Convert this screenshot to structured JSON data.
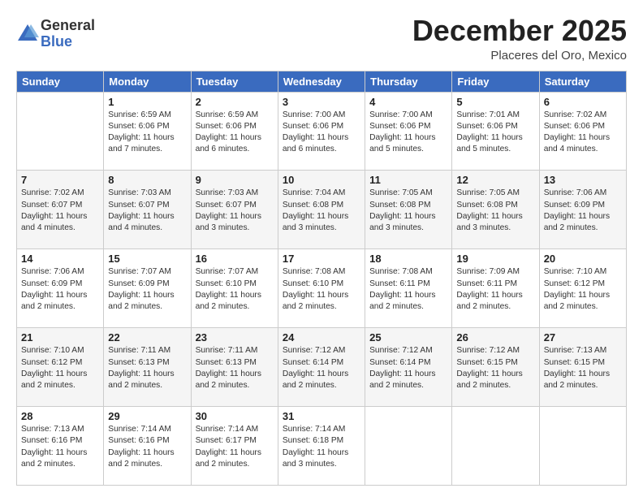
{
  "logo": {
    "general": "General",
    "blue": "Blue"
  },
  "header": {
    "month": "December 2025",
    "location": "Placeres del Oro, Mexico"
  },
  "weekdays": [
    "Sunday",
    "Monday",
    "Tuesday",
    "Wednesday",
    "Thursday",
    "Friday",
    "Saturday"
  ],
  "weeks": [
    [
      {
        "day": "",
        "info": ""
      },
      {
        "day": "1",
        "info": "Sunrise: 6:59 AM\nSunset: 6:06 PM\nDaylight: 11 hours\nand 7 minutes."
      },
      {
        "day": "2",
        "info": "Sunrise: 6:59 AM\nSunset: 6:06 PM\nDaylight: 11 hours\nand 6 minutes."
      },
      {
        "day": "3",
        "info": "Sunrise: 7:00 AM\nSunset: 6:06 PM\nDaylight: 11 hours\nand 6 minutes."
      },
      {
        "day": "4",
        "info": "Sunrise: 7:00 AM\nSunset: 6:06 PM\nDaylight: 11 hours\nand 5 minutes."
      },
      {
        "day": "5",
        "info": "Sunrise: 7:01 AM\nSunset: 6:06 PM\nDaylight: 11 hours\nand 5 minutes."
      },
      {
        "day": "6",
        "info": "Sunrise: 7:02 AM\nSunset: 6:06 PM\nDaylight: 11 hours\nand 4 minutes."
      }
    ],
    [
      {
        "day": "7",
        "info": "Sunrise: 7:02 AM\nSunset: 6:07 PM\nDaylight: 11 hours\nand 4 minutes."
      },
      {
        "day": "8",
        "info": "Sunrise: 7:03 AM\nSunset: 6:07 PM\nDaylight: 11 hours\nand 4 minutes."
      },
      {
        "day": "9",
        "info": "Sunrise: 7:03 AM\nSunset: 6:07 PM\nDaylight: 11 hours\nand 3 minutes."
      },
      {
        "day": "10",
        "info": "Sunrise: 7:04 AM\nSunset: 6:08 PM\nDaylight: 11 hours\nand 3 minutes."
      },
      {
        "day": "11",
        "info": "Sunrise: 7:05 AM\nSunset: 6:08 PM\nDaylight: 11 hours\nand 3 minutes."
      },
      {
        "day": "12",
        "info": "Sunrise: 7:05 AM\nSunset: 6:08 PM\nDaylight: 11 hours\nand 3 minutes."
      },
      {
        "day": "13",
        "info": "Sunrise: 7:06 AM\nSunset: 6:09 PM\nDaylight: 11 hours\nand 2 minutes."
      }
    ],
    [
      {
        "day": "14",
        "info": "Sunrise: 7:06 AM\nSunset: 6:09 PM\nDaylight: 11 hours\nand 2 minutes."
      },
      {
        "day": "15",
        "info": "Sunrise: 7:07 AM\nSunset: 6:09 PM\nDaylight: 11 hours\nand 2 minutes."
      },
      {
        "day": "16",
        "info": "Sunrise: 7:07 AM\nSunset: 6:10 PM\nDaylight: 11 hours\nand 2 minutes."
      },
      {
        "day": "17",
        "info": "Sunrise: 7:08 AM\nSunset: 6:10 PM\nDaylight: 11 hours\nand 2 minutes."
      },
      {
        "day": "18",
        "info": "Sunrise: 7:08 AM\nSunset: 6:11 PM\nDaylight: 11 hours\nand 2 minutes."
      },
      {
        "day": "19",
        "info": "Sunrise: 7:09 AM\nSunset: 6:11 PM\nDaylight: 11 hours\nand 2 minutes."
      },
      {
        "day": "20",
        "info": "Sunrise: 7:10 AM\nSunset: 6:12 PM\nDaylight: 11 hours\nand 2 minutes."
      }
    ],
    [
      {
        "day": "21",
        "info": "Sunrise: 7:10 AM\nSunset: 6:12 PM\nDaylight: 11 hours\nand 2 minutes."
      },
      {
        "day": "22",
        "info": "Sunrise: 7:11 AM\nSunset: 6:13 PM\nDaylight: 11 hours\nand 2 minutes."
      },
      {
        "day": "23",
        "info": "Sunrise: 7:11 AM\nSunset: 6:13 PM\nDaylight: 11 hours\nand 2 minutes."
      },
      {
        "day": "24",
        "info": "Sunrise: 7:12 AM\nSunset: 6:14 PM\nDaylight: 11 hours\nand 2 minutes."
      },
      {
        "day": "25",
        "info": "Sunrise: 7:12 AM\nSunset: 6:14 PM\nDaylight: 11 hours\nand 2 minutes."
      },
      {
        "day": "26",
        "info": "Sunrise: 7:12 AM\nSunset: 6:15 PM\nDaylight: 11 hours\nand 2 minutes."
      },
      {
        "day": "27",
        "info": "Sunrise: 7:13 AM\nSunset: 6:15 PM\nDaylight: 11 hours\nand 2 minutes."
      }
    ],
    [
      {
        "day": "28",
        "info": "Sunrise: 7:13 AM\nSunset: 6:16 PM\nDaylight: 11 hours\nand 2 minutes."
      },
      {
        "day": "29",
        "info": "Sunrise: 7:14 AM\nSunset: 6:16 PM\nDaylight: 11 hours\nand 2 minutes."
      },
      {
        "day": "30",
        "info": "Sunrise: 7:14 AM\nSunset: 6:17 PM\nDaylight: 11 hours\nand 2 minutes."
      },
      {
        "day": "31",
        "info": "Sunrise: 7:14 AM\nSunset: 6:18 PM\nDaylight: 11 hours\nand 3 minutes."
      },
      {
        "day": "",
        "info": ""
      },
      {
        "day": "",
        "info": ""
      },
      {
        "day": "",
        "info": ""
      }
    ]
  ]
}
